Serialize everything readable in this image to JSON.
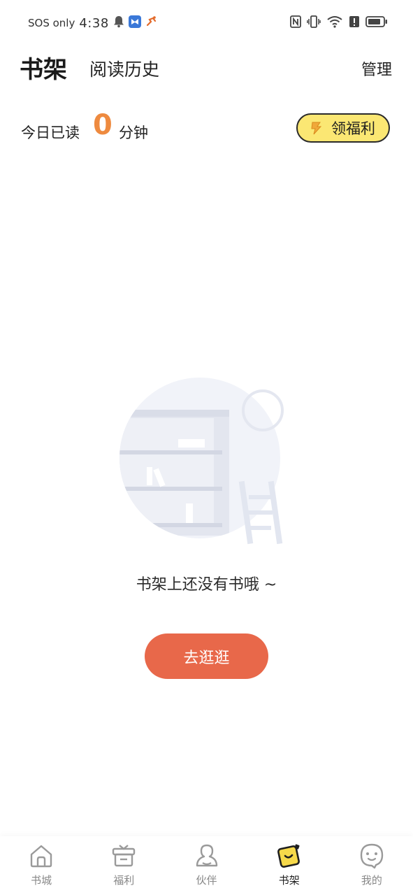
{
  "status_bar": {
    "carrier": "SOS only",
    "time": "4:38",
    "icons_left": [
      "bell-icon",
      "app-badge-icon",
      "runner-icon"
    ],
    "icons_right": [
      "nfc-icon",
      "vibrate-icon",
      "wifi-icon",
      "alert-icon",
      "battery-icon"
    ]
  },
  "header": {
    "tab_shelf": "书架",
    "tab_history": "阅读历史",
    "manage": "管理"
  },
  "reading": {
    "prefix": "今日已读",
    "count": "0",
    "suffix": "分钟",
    "welfare_label": "领福利"
  },
  "empty_state": {
    "message": "书架上还没有书哦 ~",
    "button_label": "去逛逛"
  },
  "bottom_nav": {
    "items": [
      {
        "label": "书城",
        "icon": "home-icon"
      },
      {
        "label": "福利",
        "icon": "gift-box-icon"
      },
      {
        "label": "伙伴",
        "icon": "companion-icon"
      },
      {
        "label": "书架",
        "icon": "bookshelf-icon",
        "active": true
      },
      {
        "label": "我的",
        "icon": "profile-face-icon"
      }
    ]
  },
  "colors": {
    "accent_orange": "#ee8a3f",
    "button_red": "#e8684a",
    "welfare_yellow": "#fbe773",
    "active_yellow": "#f6d94a"
  }
}
